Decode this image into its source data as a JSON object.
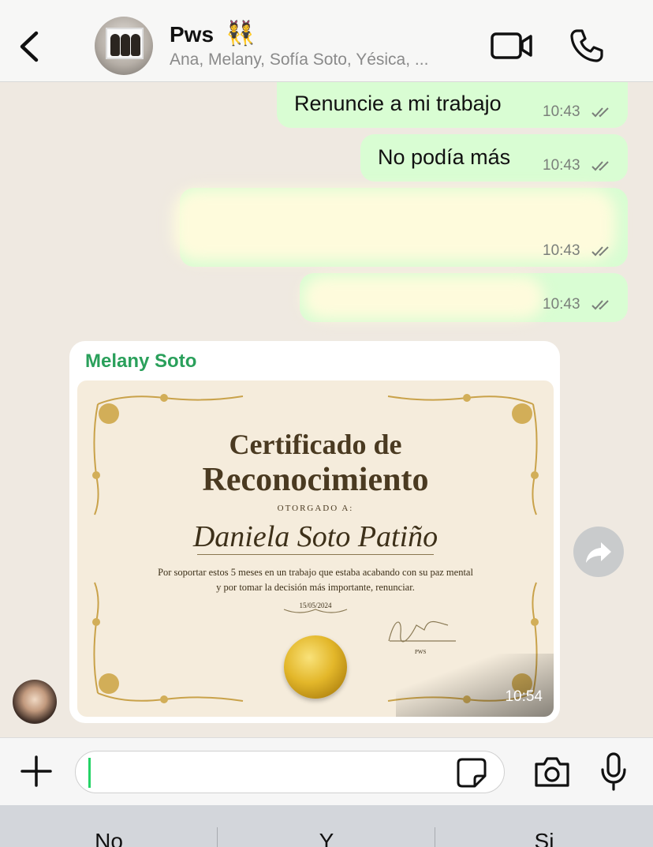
{
  "header": {
    "back_icon": "chevron-left-icon",
    "group_name": "Pws",
    "group_emoji": "👯",
    "members": "Ana, Melany, Sofía Soto, Yésica, ...",
    "video_icon": "video-camera-icon",
    "call_icon": "phone-icon"
  },
  "messages": [
    {
      "text": "Renuncie a mi trabajo",
      "time": "10:43"
    },
    {
      "text": "No podía más",
      "time": "10:43"
    },
    {
      "text": "",
      "time": "10:43"
    },
    {
      "text": "",
      "time": "10:43"
    }
  ],
  "incoming": {
    "sender": "Melany Soto",
    "time": "10:54",
    "certificate": {
      "title_line1": "Certificado de",
      "title_line2": "Reconocimiento",
      "awarded_to": "OTORGADO A:",
      "name": "Daniela Soto Patiño",
      "body": "Por soportar estos 5 meses en un trabajo que estaba acabando con su paz mental y por tomar la decisión más importante, renunciar.",
      "date": "15/05/2024",
      "signature_label": "PWS"
    }
  },
  "input": {
    "value": "",
    "plus_icon": "plus-icon",
    "sticker_icon": "sticker-icon",
    "camera_icon": "camera-icon",
    "mic_icon": "microphone-icon"
  },
  "keyboard_suggestions": [
    "No",
    "Y",
    "Si"
  ],
  "colors": {
    "outgoing_bubble": "#d9fdd3",
    "sender_name": "#2aa05b",
    "chat_background": "#efe9e1"
  }
}
